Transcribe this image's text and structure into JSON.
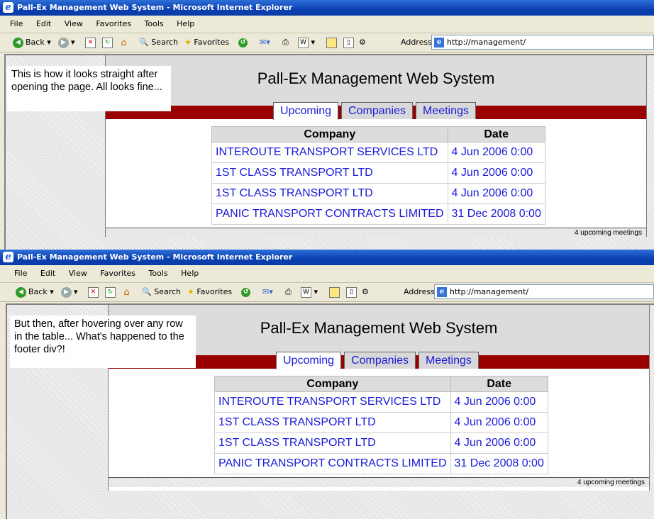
{
  "browser": {
    "window_title": "Pall-Ex Management Web System - Microsoft Internet Explorer",
    "menu": [
      "File",
      "Edit",
      "View",
      "Favorites",
      "Tools",
      "Help"
    ],
    "toolbar": {
      "back": "Back",
      "search": "Search",
      "favorites": "Favorites"
    },
    "address_label": "Address",
    "address_url": "http://management/"
  },
  "annotations": {
    "first": "This is how it looks straight after opening the page. All looks fine...",
    "second": "But then, after hovering over any row in the table... What's happened to the footer div?!"
  },
  "app": {
    "title": "Pall-Ex Management Web System",
    "tabs": [
      "Upcoming",
      "Companies",
      "Meetings"
    ],
    "active_tab": "Upcoming",
    "table": {
      "headers": [
        "Company",
        "Date"
      ],
      "rows": [
        [
          "INTEROUTE TRANSPORT SERVICES LTD",
          "4 Jun 2006 0:00"
        ],
        [
          "1ST CLASS TRANSPORT LTD",
          "4 Jun 2006 0:00"
        ],
        [
          "1ST CLASS TRANSPORT LTD",
          "4 Jun 2006 0:00"
        ],
        [
          "PANIC TRANSPORT CONTRACTS LIMITED",
          "31 Dec 2008 0:00"
        ]
      ]
    },
    "footer": "4 upcoming meetings"
  },
  "colors": {
    "header_band": "#990000",
    "link": "#1a1ad9",
    "header_bg": "#dcdcdc"
  }
}
